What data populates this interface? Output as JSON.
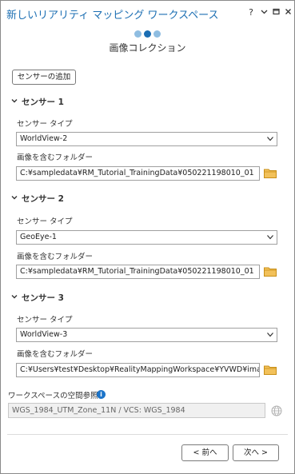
{
  "window": {
    "title": "新しいリアリティ マッピング ワークスペース",
    "help_label": "?",
    "menu_label": "▾",
    "restore_label": "▭",
    "close_label": "✕"
  },
  "steps": {
    "count": 3,
    "active": 2,
    "title": "画像コレクション"
  },
  "add_sensor_label": "センサーの追加",
  "sensors": [
    {
      "header": "センサー 1",
      "type_label": "センサー タイプ",
      "type_value": "WorldView-2",
      "folder_label": "画像を含むフォルダー",
      "folder_value": "C:¥sampledata¥RM_Tutorial_TrainingData¥050221198010_01"
    },
    {
      "header": "センサー 2",
      "type_label": "センサー タイプ",
      "type_value": "GeoEye-1",
      "folder_label": "画像を含むフォルダー",
      "folder_value": "C:¥sampledata¥RM_Tutorial_TrainingData¥050221198010_01"
    },
    {
      "header": "センサー 3",
      "type_label": "センサー タイプ",
      "type_value": "WorldView-3",
      "folder_label": "画像を含むフォルダー",
      "folder_value": "C:¥Users¥test¥Desktop¥RealityMappingWorkspace¥YVWD¥images"
    }
  ],
  "spatial_ref": {
    "label": "ワークスペースの空間参照",
    "info_icon": "i",
    "value": "WGS_1984_UTM_Zone_11N / VCS: WGS_1984"
  },
  "nav": {
    "back_label": "< 前へ",
    "next_label": "次へ >"
  },
  "colors": {
    "accent": "#1a6db3",
    "step_inactive": "#8fbde1",
    "folder": "#e0a82e"
  }
}
